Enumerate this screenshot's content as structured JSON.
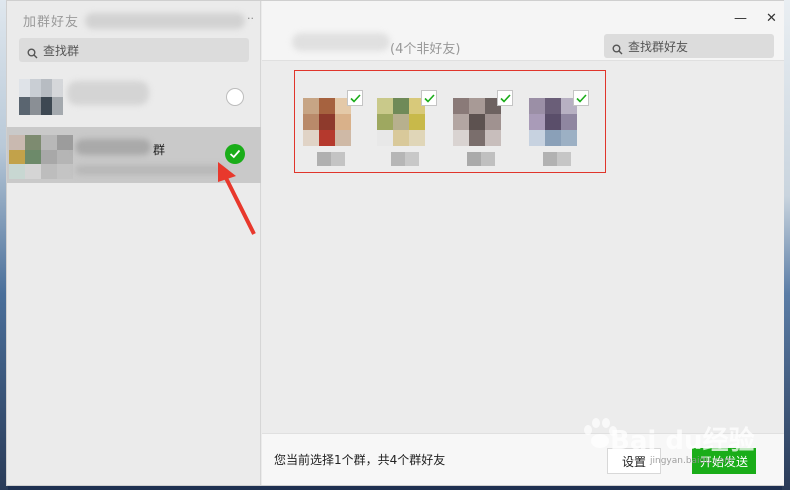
{
  "left": {
    "title": "加群好友",
    "search_placeholder": "查找群",
    "rows": [
      {
        "name": "",
        "checked": false
      },
      {
        "name": "群",
        "checked": true
      }
    ]
  },
  "right": {
    "selection_count": "(4个非好友)",
    "search_placeholder": "查找群好友",
    "minimize": "—",
    "close": "✕",
    "friends": [
      {
        "checked": true
      },
      {
        "checked": true
      },
      {
        "checked": true
      },
      {
        "checked": true
      }
    ],
    "summary": "您当前选择1个群，共4个群好友",
    "settings_label": "设置",
    "send_label": "开始发送"
  },
  "watermark": {
    "text": "Bai du经验",
    "sub": "jingyan.baidu.com"
  },
  "colors": {
    "accent_green": "#1aad19",
    "highlight_red": "#e0352b"
  }
}
